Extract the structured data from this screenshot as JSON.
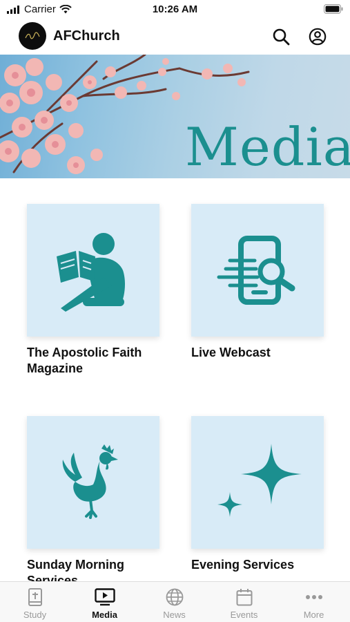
{
  "status_bar": {
    "carrier": "Carrier",
    "time": "10:26 AM"
  },
  "header": {
    "app_title": "AFChurch"
  },
  "banner": {
    "title": "Media"
  },
  "cards": [
    {
      "label": "The Apostolic Faith Magazine",
      "icon": "reading-person-icon"
    },
    {
      "label": "Live Webcast",
      "icon": "phone-search-icon"
    },
    {
      "label": "Sunday Morning Services",
      "icon": "rooster-icon"
    },
    {
      "label": "Evening Services",
      "icon": "sparkle-stars-icon"
    }
  ],
  "tabs": [
    {
      "label": "Study",
      "icon": "bible-icon"
    },
    {
      "label": "Media",
      "icon": "tv-play-icon",
      "active": true
    },
    {
      "label": "News",
      "icon": "globe-icon"
    },
    {
      "label": "Events",
      "icon": "calendar-icon"
    },
    {
      "label": "More",
      "icon": "more-dots-icon"
    }
  ],
  "colors": {
    "accent": "#1b8f8f",
    "tile": "#d8ebf7",
    "active_tab": "#111111",
    "inactive_tab": "#999999"
  }
}
